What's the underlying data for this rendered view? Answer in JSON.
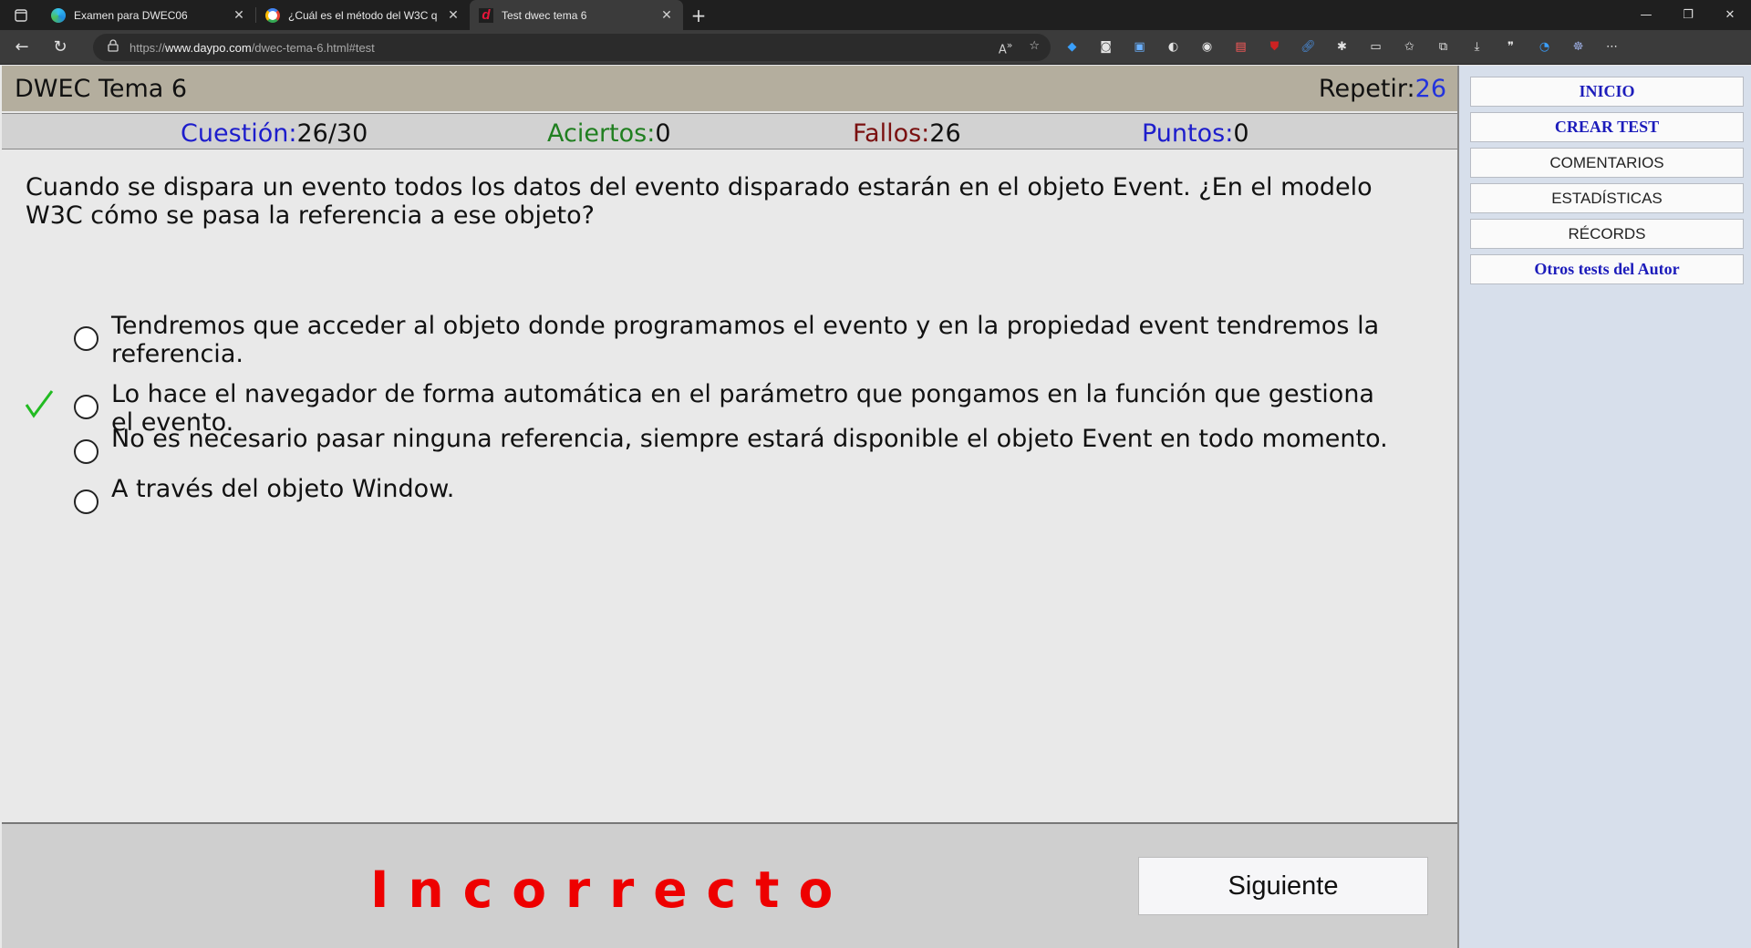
{
  "browser": {
    "tabs": [
      {
        "title": "Examen para DWEC06",
        "active": false
      },
      {
        "title": "¿Cuál es el método del W3C que",
        "active": false
      },
      {
        "title": "Test dwec tema 6",
        "active": true
      }
    ],
    "url_prefix": "https://",
    "url_host": "www.daypo.com",
    "url_path": "/dwec-tema-6.html#test"
  },
  "header": {
    "title": "DWEC Tema 6",
    "repeat_label": "Repetir:",
    "repeat_value": "26"
  },
  "stats": {
    "question_label": "Cuestión:",
    "question_value": "26/30",
    "correct_label": "Aciertos:",
    "correct_value": "0",
    "wrong_label": "Fallos:",
    "wrong_value": "26",
    "points_label": "Puntos:",
    "points_value": "0"
  },
  "question": {
    "text": "Cuando se dispara un evento todos los datos del evento disparado estarán en el objeto Event. ¿En el modelo W3C cómo se pasa la referencia a ese objeto?",
    "options": [
      {
        "text": "Tendremos que acceder al objeto donde programamos el evento y en la propiedad event tendremos la referencia.",
        "correct": false
      },
      {
        "text": "Lo hace el navegador de forma automática en el parámetro que pongamos en la función que gestiona el evento.",
        "correct": true
      },
      {
        "text": "No es necesario pasar ninguna referencia, siempre estará disponible el objeto Event en todo momento.",
        "correct": false
      },
      {
        "text": "A través del objeto Window.",
        "correct": false
      }
    ]
  },
  "footer": {
    "result": "Incorrecto",
    "next_label": "Siguiente"
  },
  "sidebar": {
    "items": [
      {
        "label": "INICIO"
      },
      {
        "label": "CREAR TEST"
      },
      {
        "label": "COMENTARIOS"
      },
      {
        "label": "ESTADÍSTICAS"
      },
      {
        "label": "RÉCORDS"
      },
      {
        "label": "Otros tests del Autor"
      }
    ]
  },
  "colors": {
    "result": "#ee0000",
    "check": "#22bb22",
    "title_bar": "#b4ae9e",
    "sidebar_link": "#1c1cbb"
  }
}
